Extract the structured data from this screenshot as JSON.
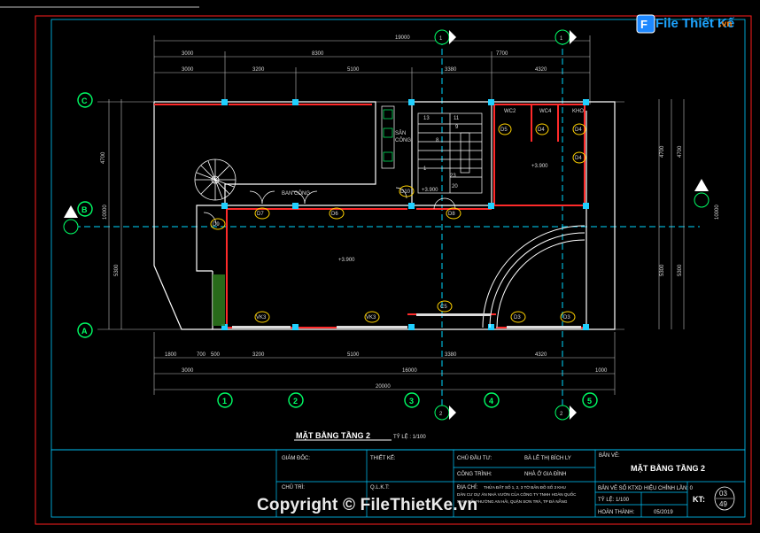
{
  "brand": {
    "logo_text": "File Thiết Kế",
    "logo_suffix": ".vn",
    "watermark": "Copyright © FileThietKe.vn"
  },
  "drawing": {
    "title": "MẶT BẰNG TẦNG 2",
    "scale": "TỶ LỆ : 1/100",
    "dims_top_total": "19000",
    "dims_top_row2": [
      "3000",
      "8300",
      "7700"
    ],
    "dims_top_row3": [
      "3000",
      "3200",
      "5100",
      "3380",
      "4320"
    ],
    "dims_bottom_row1": [
      "1800",
      "700",
      "500",
      "3200",
      "5100",
      "3380",
      "4320"
    ],
    "dims_bottom_row2": [
      "3000",
      "16000",
      "1000"
    ],
    "dims_bottom_total": "20000",
    "dims_left": [
      "4700",
      "10000",
      "5300"
    ],
    "dims_right": [
      "4700",
      "4700",
      "10000",
      "5300",
      "5300"
    ],
    "grid_cols": [
      "1",
      "2",
      "3",
      "4",
      "5"
    ],
    "grid_rows": [
      "C",
      "B",
      "A"
    ],
    "section_labels": [
      "1",
      "1",
      "2",
      "2"
    ],
    "rooms": {
      "ban_cong": "BAN CÔNG",
      "san_cong": "SÂN\nCÔNG",
      "wc2": "WC2",
      "wc4": "WC4",
      "kho": "KHO",
      "level_main": "+3.900",
      "level_right": "+3.900",
      "level_hall": "+3.900"
    },
    "doors": [
      "D7",
      "D6",
      "D9",
      "D10",
      "D8",
      "D4",
      "D5",
      "D4",
      "D4",
      "D3"
    ],
    "windows": [
      "VK3",
      "VK3",
      "D3",
      "D3",
      "C5"
    ],
    "stairs": [
      "13",
      "11",
      "20",
      "9",
      "23",
      "1",
      "8"
    ]
  },
  "title_block": {
    "giam_doc": "GIÁM ĐỐC:",
    "thiet_ke": "THIẾT KẾ:",
    "chu_tri": "CHỦ TRÌ:",
    "qlkt": "Q.L.K.T:",
    "chu_dau_tu_label": "CHỦ ĐẦU TƯ:",
    "chu_dau_tu_value": "BÀ LÊ THỊ BÍCH LY",
    "cong_trinh_label": "CÔNG TRÌNH:",
    "cong_trinh_value": "NHÀ Ở GIA ĐÌNH",
    "dia_chi_label": "ĐỊA CHỈ:",
    "dia_chi_value_1": "THỬA ĐẤT SỐ 1, 2, 3 TỜ BẢN ĐỒ SỐ 3 KHU",
    "dia_chi_value_2": "DÂN CƯ DỰ ÁN NHÀ VƯỜN CỦA CÔNG TY TNHH HOÀN QUỐC",
    "dia_chi_value_3": "NHƯ CỐ, PHƯỜNG AN HẢI, QUẬN SƠN TRÀ, TP ĐÀ NẴNG",
    "ban_ve_label": "BẢN VẼ:",
    "ban_ve_value": "MẶT BẰNG TẦNG 2",
    "ban_ve_so": "BẢN VẼ SỐ KTXD",
    "hieu_chinh": "HIỆU CHỈNH LẦN: 0",
    "ty_le": "TỶ LỆ: 1/100",
    "hoan_thanh": "HOÀN THÀNH:",
    "ngay": "05/2019",
    "kt_label": "KT:",
    "kt_num": "03",
    "kt_den": "49"
  },
  "colors": {
    "grid": "#00d8ff",
    "walls": "#ff2a2a",
    "outline": "#ffffff",
    "axis": "#00ff66",
    "frame": "#ff0000"
  }
}
